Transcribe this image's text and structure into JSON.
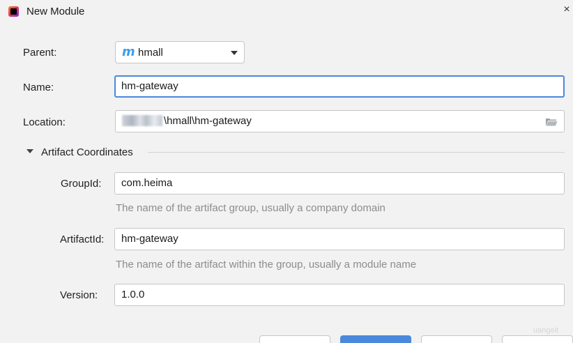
{
  "window": {
    "title": "New Module",
    "close_glyph": "×"
  },
  "form": {
    "parent": {
      "label": "Parent:",
      "icon_glyph": "m",
      "value": "hmall"
    },
    "name": {
      "label": "Name:",
      "value": "hm-gateway"
    },
    "location": {
      "label": "Location:",
      "value_suffix": "\\hmall\\hm-gateway"
    }
  },
  "artifact": {
    "section_title": "Artifact Coordinates",
    "group_id": {
      "label": "GroupId:",
      "value": "com.heima",
      "hint": "The name of the artifact group, usually a company domain"
    },
    "artifact_id": {
      "label": "ArtifactId:",
      "value": "hm-gateway",
      "hint": "The name of the artifact within the group, usually a module name"
    },
    "version": {
      "label": "Version:",
      "value": "1.0.0"
    }
  },
  "watermark": "uangeit",
  "colors": {
    "accent": "#4a89dc",
    "maven_icon": "#3d9ee8",
    "hint": "#8c8c8c"
  }
}
